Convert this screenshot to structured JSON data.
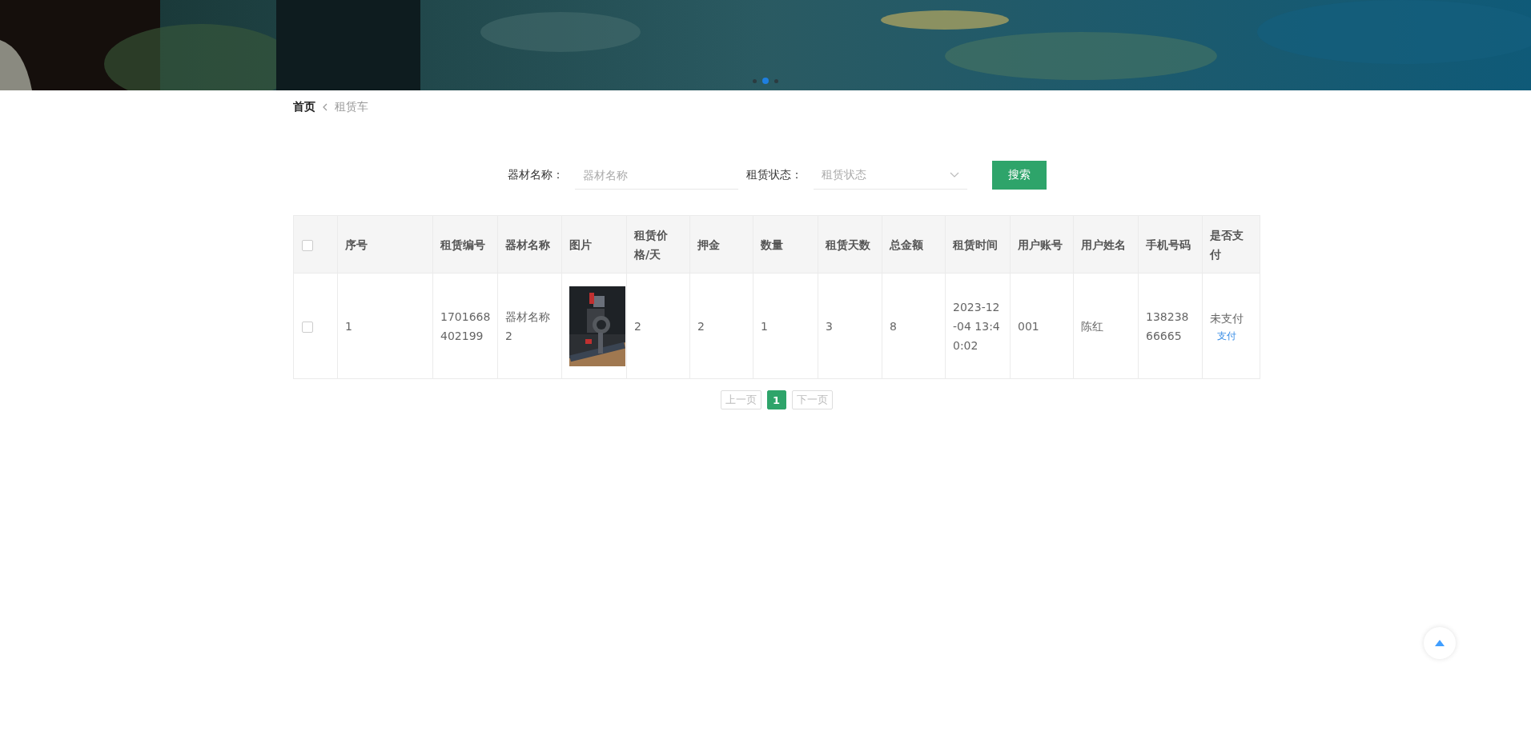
{
  "banner": {
    "kind": "picture",
    "dots": [
      {
        "selected": false
      },
      {
        "selected": true
      },
      {
        "selected": false
      }
    ]
  },
  "breadcrumb": [
    {
      "label": "首页",
      "current": false
    },
    {
      "label": "租赁车",
      "current": true
    }
  ],
  "search": {
    "fields": [
      {
        "kind": "input",
        "label": "器材名称：",
        "placeholder": "器材名称"
      },
      {
        "kind": "select",
        "label": "租赁状态：",
        "placeholder": "租赁状态"
      }
    ],
    "button": "搜索"
  },
  "table": {
    "select_all": {
      "checked": false
    },
    "columns": [
      "序号",
      "租赁编号",
      "器材名称",
      "图片",
      "租赁价格/天",
      "押金",
      "数量",
      "租赁天数",
      "总金额",
      "租赁时间",
      "用户账号",
      "用户姓名",
      "手机号码",
      "是否支付"
    ],
    "rows": [
      {
        "checked": false,
        "cells": [
          {
            "kind": "text",
            "text": "1"
          },
          {
            "kind": "text",
            "text": "1701668402199"
          },
          {
            "kind": "text",
            "text": "器材名称2"
          },
          {
            "kind": "picture"
          },
          {
            "kind": "text",
            "text": "2"
          },
          {
            "kind": "text",
            "text": "2"
          },
          {
            "kind": "text",
            "text": "1"
          },
          {
            "kind": "text",
            "text": "3"
          },
          {
            "kind": "text",
            "text": "8"
          },
          {
            "kind": "text",
            "text": "2023-12-04 13:40:02"
          },
          {
            "kind": "text",
            "text": "001"
          },
          {
            "kind": "text",
            "text": "陈红"
          },
          {
            "kind": "text",
            "text": "13823866665"
          },
          {
            "kind": "pay",
            "text": "未支付",
            "link": "支付"
          }
        ]
      }
    ]
  },
  "pagination": {
    "prev": {
      "label": "上一页",
      "disabled": true
    },
    "pages": [
      {
        "label": "1",
        "selected": true
      }
    ],
    "next": {
      "label": "下一页",
      "disabled": true
    }
  }
}
